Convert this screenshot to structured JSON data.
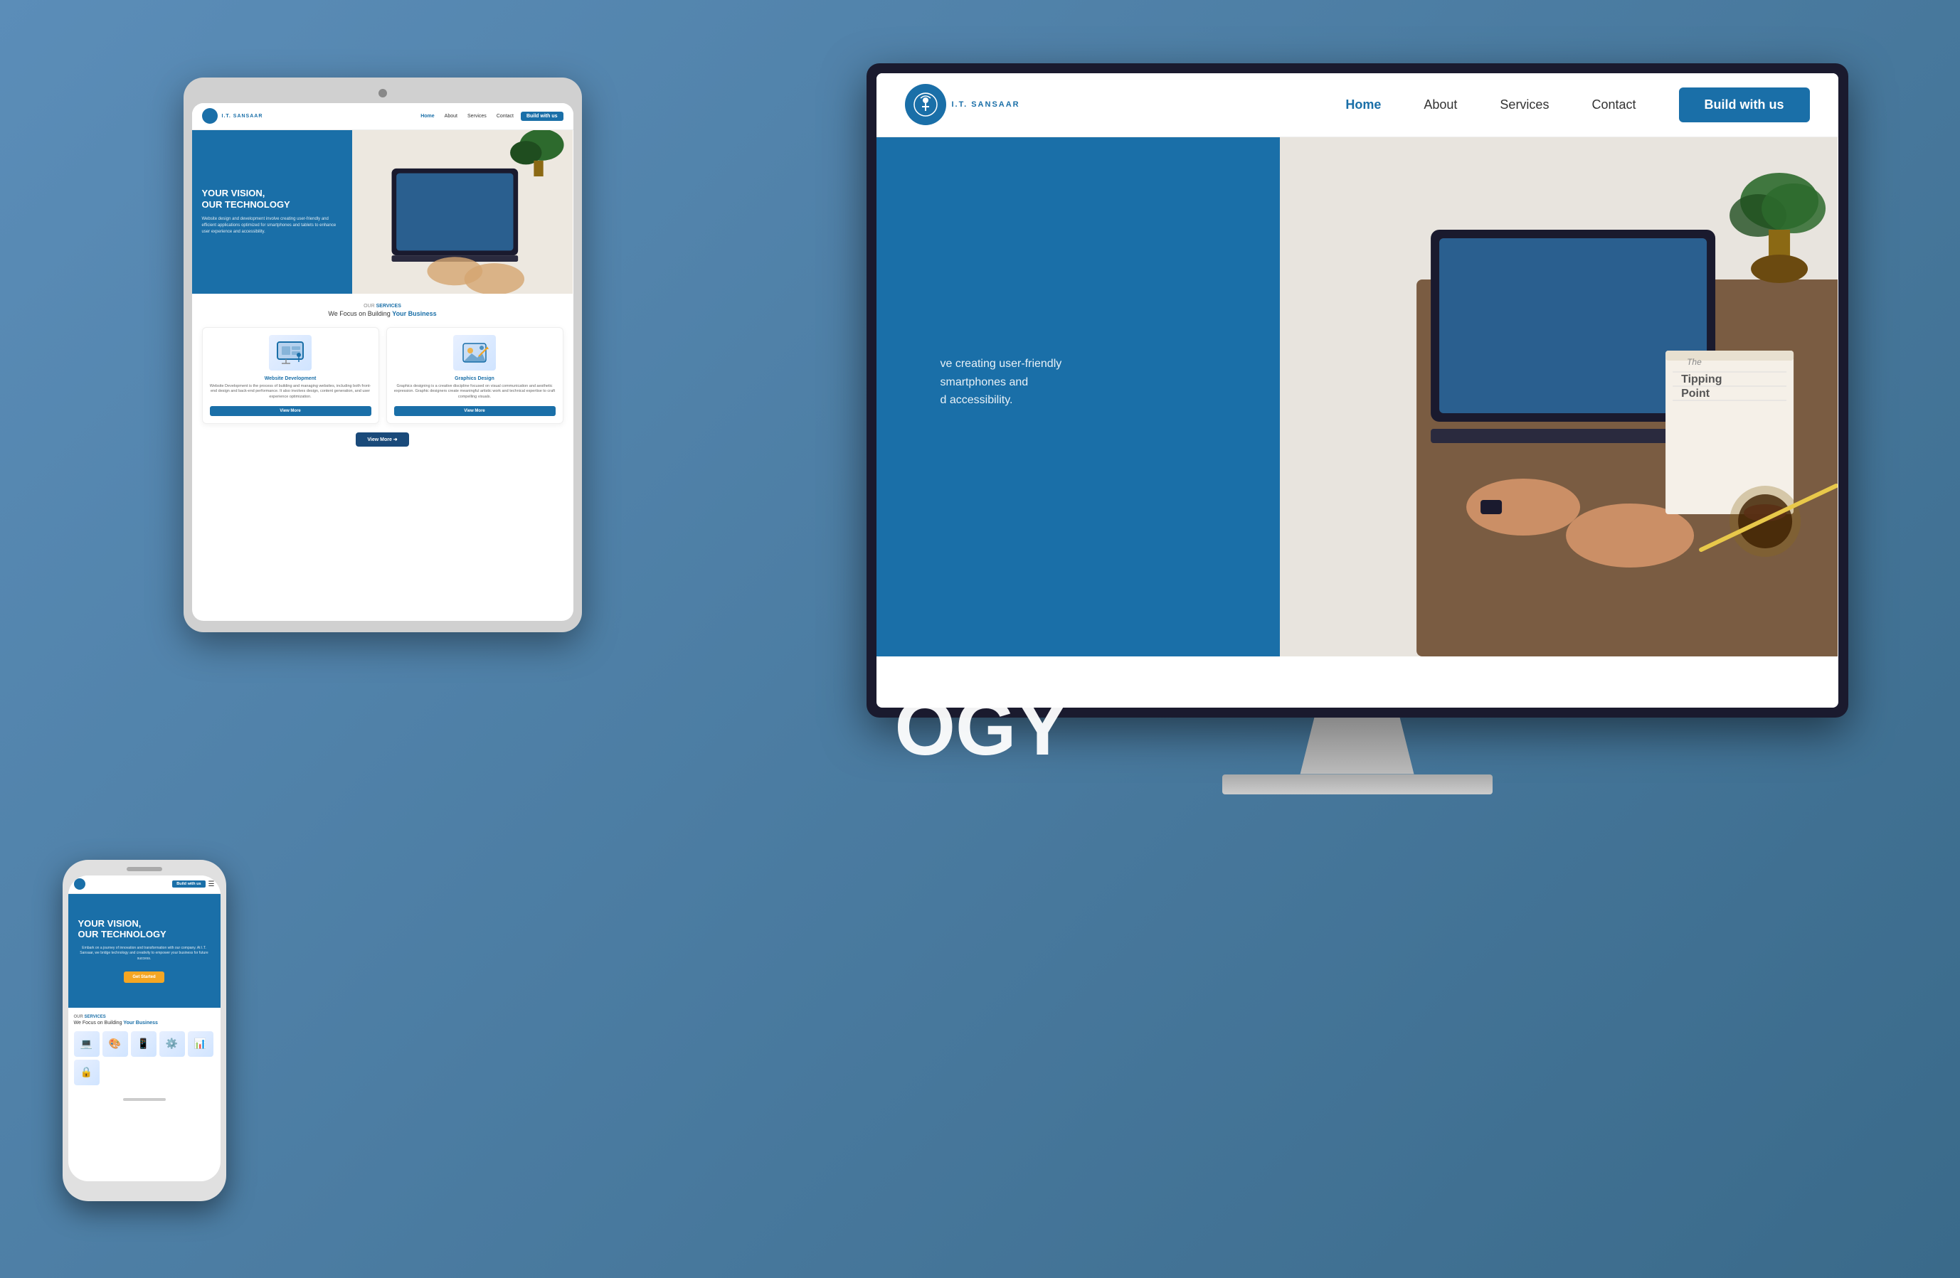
{
  "brand": {
    "name": "I.T. SANSAAR",
    "tagline": "YOUR VISION, OUR TECHNOLOGY"
  },
  "desktop": {
    "nav": {
      "links": [
        {
          "label": "Home",
          "active": true
        },
        {
          "label": "About",
          "active": false
        },
        {
          "label": "Services",
          "active": false
        },
        {
          "label": "Contact",
          "active": false
        }
      ],
      "cta": "Build with us"
    },
    "hero": {
      "title": "OGY",
      "subtitle_line1": "ve creating user-friendly",
      "subtitle_line2": "smartphones and",
      "subtitle_line3": "d accessibility."
    }
  },
  "tablet": {
    "nav": {
      "links": [
        {
          "label": "Home",
          "active": true
        },
        {
          "label": "About",
          "active": false
        },
        {
          "label": "Services",
          "active": false
        },
        {
          "label": "Contact",
          "active": false
        }
      ],
      "cta": "Build with us"
    },
    "hero": {
      "title": "YOUR VISION,\nOUR TECHNOLOGY",
      "description": "Website design and development involve creating user-friendly and efficient applications optimized for smartphones and tablets to enhance user experience and accessibility."
    },
    "services": {
      "label": "OUR SERVICES",
      "heading": "We Focus on Building ",
      "heading_accent": "Your Business",
      "cards": [
        {
          "title": "Website Development",
          "description": "Website Development is the process of building and managing websites, including both front-end design and back-end performance. It also involves design, content generation, and user experience optimization.",
          "cta": "View More"
        },
        {
          "title": "Graphics Design",
          "description": "Graphics designing is a creative discipline focused on visual communication and aesthetic expression. Graphic designers create meaningful artistic work and technical expertise to craft compelling visuals.",
          "cta": "View More"
        }
      ],
      "view_more": "View More"
    }
  },
  "phone": {
    "nav": {
      "cta": "Build with us"
    },
    "hero": {
      "title": "YOUR VISION,\nOUR TECHNOLOGY",
      "description": "Embark on a journey of innovation and transformation with our company. At I.T. Sansaar, we bridge technology and creativity to empower your business for future success.",
      "cta": "Get Started"
    },
    "services": {
      "label": "OUR SERVICES",
      "heading": "We Focus on Building ",
      "heading_accent": "Your Business",
      "icons": [
        "💻",
        "🎨",
        "📱",
        "⚙️",
        "📊",
        "🔒"
      ]
    }
  },
  "colors": {
    "primary": "#1a6fa8",
    "accent": "#f5a623",
    "dark": "#1a1a2e",
    "white": "#ffffff",
    "light_bg": "#f5f5f5"
  }
}
